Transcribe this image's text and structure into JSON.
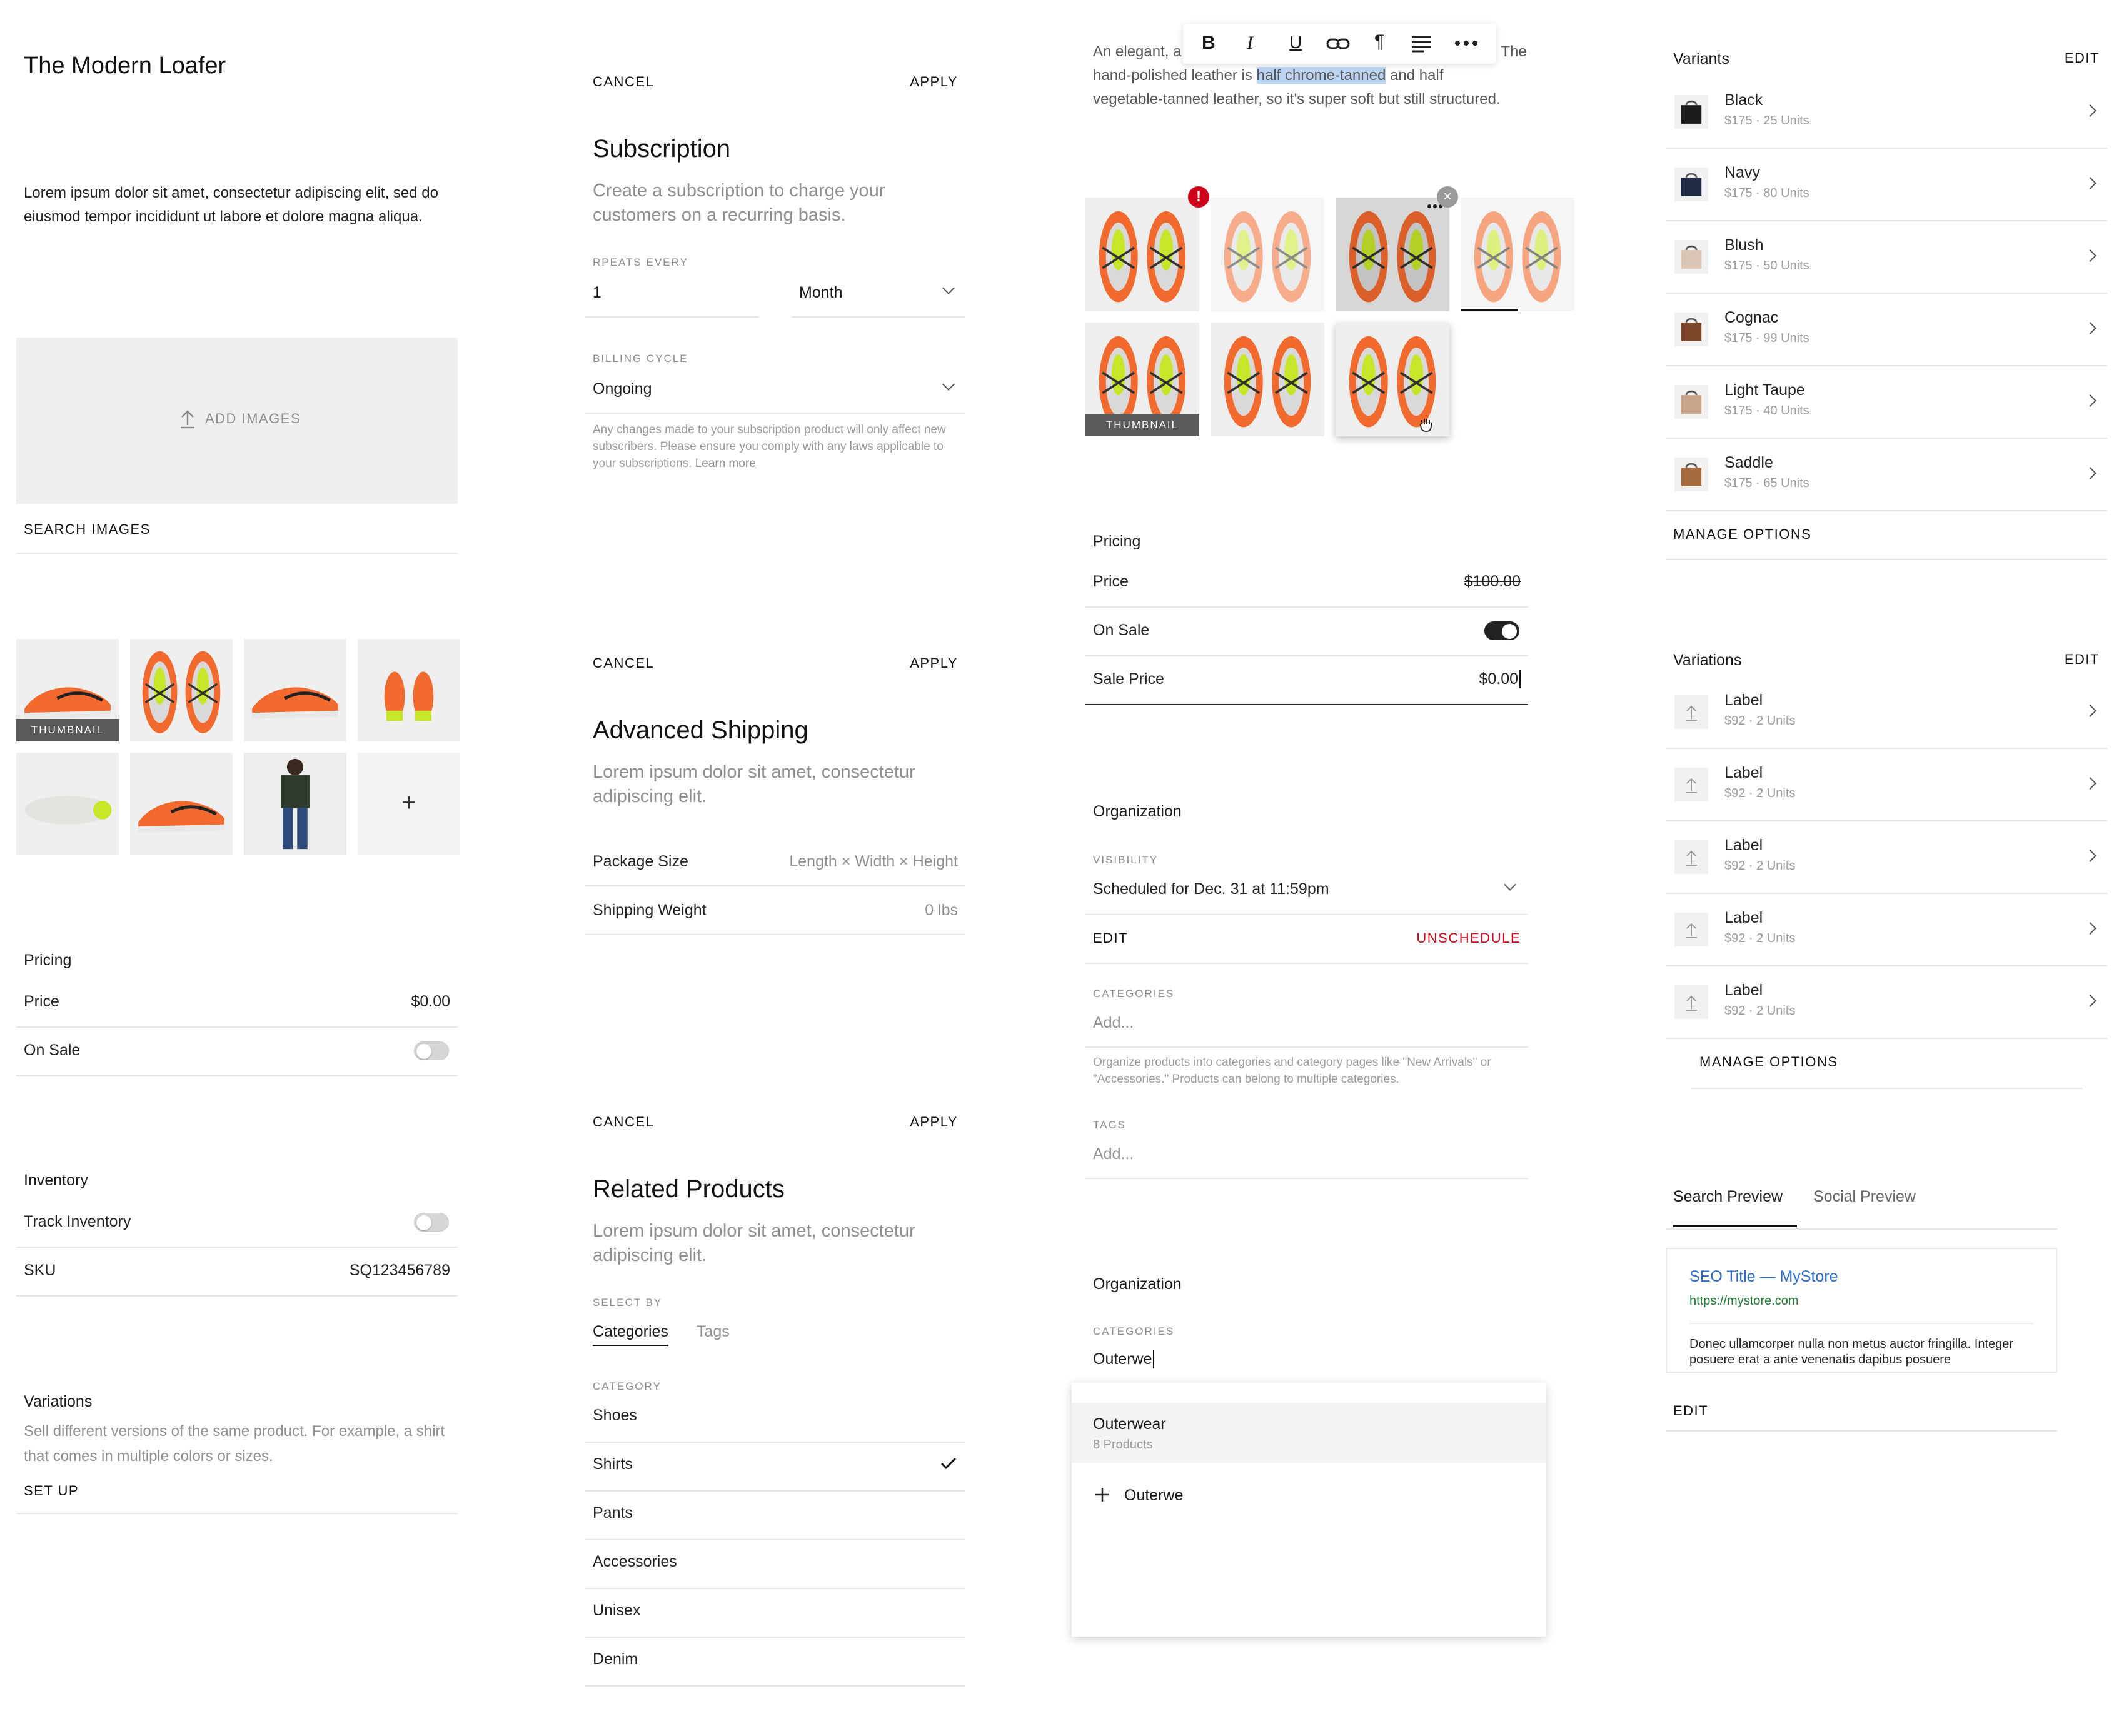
{
  "col1": {
    "product_title": "The Modern Loafer",
    "description": "Lorem ipsum dolor sit amet, consectetur adipiscing elit, sed do eiusmod tempor incididunt ut labore et dolore magna aliqua.",
    "add_images": "ADD IMAGES",
    "search_images": "SEARCH IMAGES",
    "thumbnail_tag": "THUMBNAIL",
    "add_tile": "+",
    "pricing": {
      "heading": "Pricing",
      "price_label": "Price",
      "price_value": "$0.00",
      "on_sale_label": "On Sale"
    },
    "inventory": {
      "heading": "Inventory",
      "track_label": "Track Inventory",
      "sku_label": "SKU",
      "sku_value": "SQ123456789"
    },
    "variations": {
      "heading": "Variations",
      "description": "Sell different versions of the same product. For example, a shirt that comes in multiple colors or sizes.",
      "setup": "SET UP"
    }
  },
  "subscription": {
    "cancel": "CANCEL",
    "apply": "APPLY",
    "title": "Subscription",
    "subtitle": "Create a subscription to charge your customers on a recurring basis.",
    "repeats_label": "RPEATS EVERY",
    "repeats_value": "1",
    "period": "Month",
    "billing_label": "BILLING CYCLE",
    "billing_value": "Ongoing",
    "note": "Any changes made to your subscription product will only affect new subscribers. Please ensure you comply with any laws applicable to your subscriptions.",
    "learn_more": "Learn more"
  },
  "shipping": {
    "cancel": "CANCEL",
    "apply": "APPLY",
    "title": "Advanced Shipping",
    "subtitle": "Lorem ipsum dolor sit amet, consectetur adipiscing elit.",
    "package_label": "Package Size",
    "package_placeholder": "Length × Width × Height",
    "weight_label": "Shipping Weight",
    "weight_placeholder": "0 lbs"
  },
  "related": {
    "cancel": "CANCEL",
    "apply": "APPLY",
    "title": "Related Products",
    "subtitle": "Lorem ipsum dolor sit amet, consectetur adipiscing elit.",
    "select_by": "SELECT BY",
    "tabs": [
      "Categories",
      "Tags"
    ],
    "category_label": "CATEGORY",
    "categories": [
      "Shoes",
      "Shirts",
      "Pants",
      "Accessories",
      "Unisex",
      "Denim"
    ],
    "checked": "Shirts"
  },
  "editor": {
    "line1_a": "An elegant, a",
    "line1_b": "s. The",
    "line2_a": "hand-polished leather is ",
    "line2_sel": "half chrome-tanned",
    "line2_b": " and half",
    "line3": "vegetable-tanned leather, so it's super soft but still structured.",
    "toolbar": [
      "B",
      "I",
      "U",
      "link",
      "¶",
      "align",
      "more"
    ],
    "thumbnail_tag": "THUMBNAIL",
    "error_badge": "!"
  },
  "pricing2": {
    "heading": "Pricing",
    "price_label": "Price",
    "price_value": "$100.00",
    "on_sale_label": "On Sale",
    "sale_label": "Sale Price",
    "sale_value": "$0.00"
  },
  "organization": {
    "heading": "Organization",
    "visibility_label": "VISIBILITY",
    "visibility_value": "Scheduled for Dec. 31 at 11:59pm",
    "edit": "EDIT",
    "unschedule": "UNSCHEDULE",
    "categories_label": "CATEGORIES",
    "categories_placeholder": "Add...",
    "categories_help": "Organize products into categories and category pages like \"New Arrivals\" or \"Accessories.\" Products can belong to multiple categories.",
    "tags_label": "TAGS",
    "tags_placeholder": "Add..."
  },
  "organization2": {
    "heading": "Organization",
    "categories_label": "CATEGORIES",
    "input_value": "Outerwe",
    "suggestion_name": "Outerwear",
    "suggestion_count": "8 Products",
    "create_label": "Outerwe"
  },
  "variants": {
    "heading": "Variants",
    "edit": "EDIT",
    "items": [
      {
        "name": "Black",
        "meta": "$175 · 25 Units",
        "color": "#1c1c1c"
      },
      {
        "name": "Navy",
        "meta": "$175 · 80 Units",
        "color": "#1f2b44"
      },
      {
        "name": "Blush",
        "meta": "$175 · 50 Units",
        "color": "#dcc4b4"
      },
      {
        "name": "Cognac",
        "meta": "$175 · 99 Units",
        "color": "#7a4528"
      },
      {
        "name": "Light Taupe",
        "meta": "$175 · 40 Units",
        "color": "#c8a48a"
      },
      {
        "name": "Saddle",
        "meta": "$175 · 65 Units",
        "color": "#a66b3e"
      }
    ],
    "manage": "MANAGE OPTIONS"
  },
  "variations": {
    "heading": "Variations",
    "edit": "EDIT",
    "items": [
      {
        "name": "Label",
        "meta": "$92 · 2 Units"
      },
      {
        "name": "Label",
        "meta": "$92 · 2 Units"
      },
      {
        "name": "Label",
        "meta": "$92 · 2 Units"
      },
      {
        "name": "Label",
        "meta": "$92 · 2 Units"
      },
      {
        "name": "Label",
        "meta": "$92 · 2 Units"
      }
    ],
    "manage": "MANAGE OPTIONS"
  },
  "seo": {
    "tabs": [
      "Search Preview",
      "Social Preview"
    ],
    "seo_title": "SEO Title — MyStore",
    "url": "https://mystore.com",
    "description": "Donec ullamcorper nulla non metus auctor fringilla. Integer posuere erat a ante venenatis dapibus posuere",
    "edit": "EDIT"
  },
  "colors": {
    "accent_orange": "#f26a2e",
    "danger": "#d0021b",
    "link_blue": "#2b6cc4",
    "url_green": "#1e7a34",
    "selection": "#bcd5f5"
  }
}
